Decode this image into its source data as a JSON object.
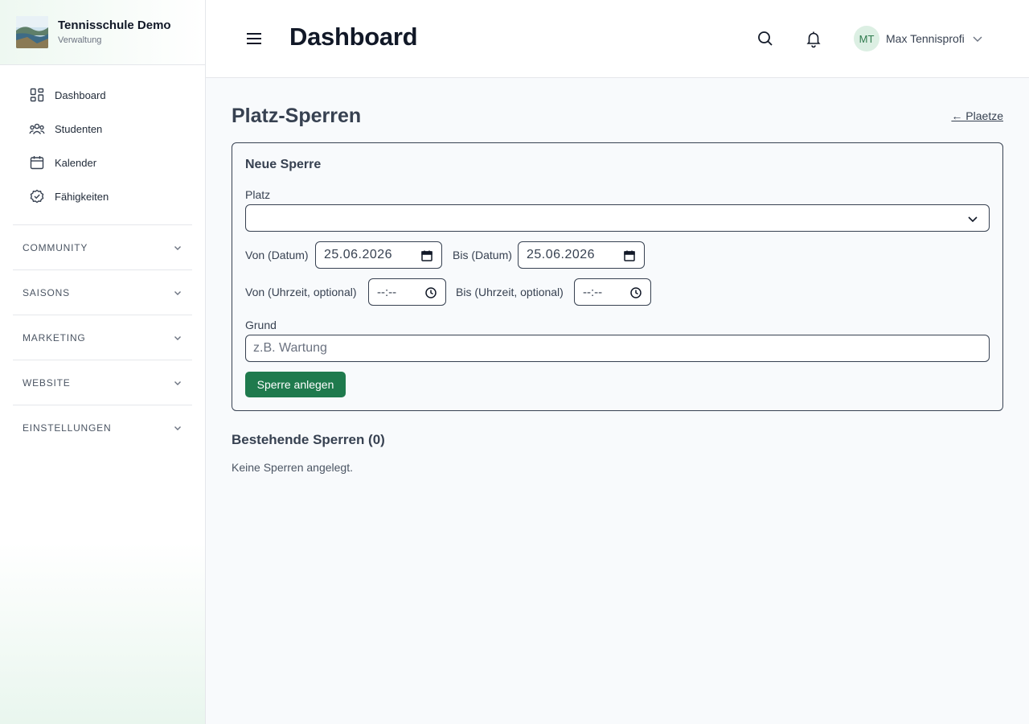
{
  "brand": {
    "name": "Tennisschule Demo",
    "subtitle": "Verwaltung"
  },
  "sidebar": {
    "items": [
      {
        "label": "Dashboard",
        "icon": "grid-icon"
      },
      {
        "label": "Studenten",
        "icon": "users-icon"
      },
      {
        "label": "Kalender",
        "icon": "calendar-icon"
      },
      {
        "label": "Fähigkeiten",
        "icon": "check-circle-icon"
      }
    ],
    "sections": [
      {
        "label": "COMMUNITY"
      },
      {
        "label": "SAISONS"
      },
      {
        "label": "MARKETING"
      },
      {
        "label": "WEBSITE"
      },
      {
        "label": "EINSTELLUNGEN"
      }
    ]
  },
  "header": {
    "title": "Dashboard",
    "user": {
      "initials": "MT",
      "name": "Max Tennisprofi"
    }
  },
  "main": {
    "title": "Platz-Sperren",
    "back_link": "← Plaetze",
    "form": {
      "title": "Neue Sperre",
      "platz_label": "Platz",
      "platz_value": "",
      "von_datum_label": "Von (Datum)",
      "von_datum_value": "25.06.2026",
      "bis_datum_label": "Bis (Datum)",
      "bis_datum_value": "25.06.2026",
      "von_zeit_label": "Von (Uhrzeit, optional)",
      "von_zeit_value": "--:--",
      "bis_zeit_label": "Bis (Uhrzeit, optional)",
      "bis_zeit_value": "--:--",
      "grund_label": "Grund",
      "grund_placeholder": "z.B. Wartung",
      "submit_label": "Sperre anlegen"
    },
    "existing": {
      "title": "Bestehende Sperren (0)",
      "empty_text": "Keine Sperren angelegt."
    }
  },
  "colors": {
    "accent": "#1f7a4d",
    "avatar_bg": "#dcefe3",
    "border": "#374151"
  }
}
